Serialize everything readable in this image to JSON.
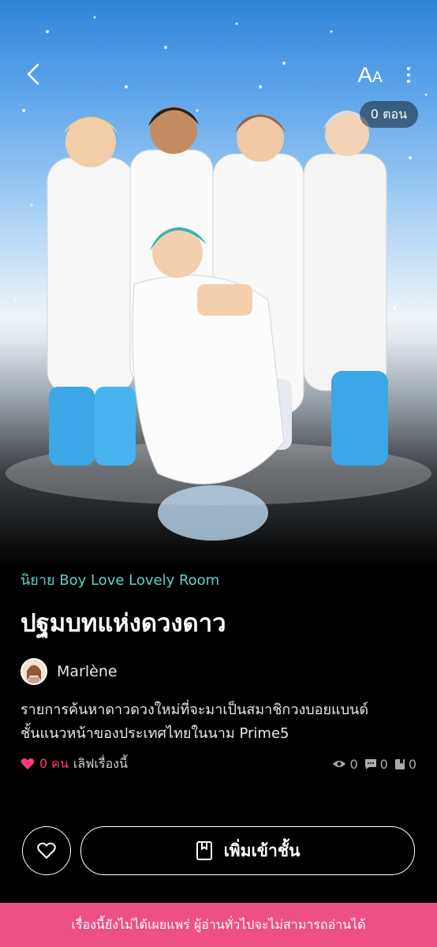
{
  "header": {
    "font_size_icon": {
      "big": "A",
      "small": "A"
    },
    "episodes_badge": "0 ตอน"
  },
  "novel": {
    "category": "นิยาย Boy Love Lovely Room",
    "title": "ปฐมบทแห่งดวงดาว",
    "author": "Marlène",
    "description_line1": "รายการค้นหาดาวดวงใหม่ที่จะมาเป็นสมาชิกวงบอยแบนด์",
    "description_line2": "ชั้นแนวหน้าของประเทศไทยในนาม Prime5",
    "likes_count": "0 คน",
    "likes_text": "เลิฟเรื่องนี้",
    "views": "0",
    "comments": "0",
    "bookmarks": "0"
  },
  "actions": {
    "add_to_shelf": "เพิ่มเข้าชั้น"
  },
  "notice": "เรื่องนี้ยังไม่ได้เผยแพร่ ผู้อ่านทั่วไปจะไม่สามารถอ่านได้",
  "colors": {
    "accent_teal": "#5fd3c2",
    "notice_pink": "#ee4f86",
    "heart_pink": "#ff3b7a"
  }
}
